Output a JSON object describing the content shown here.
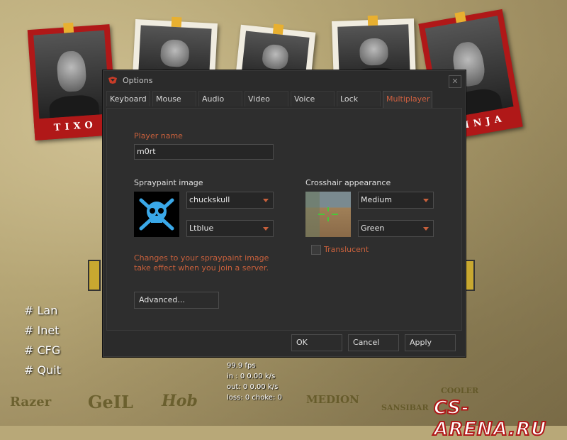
{
  "dialog": {
    "title": "Options",
    "close_symbol": "✕",
    "tabs": [
      {
        "label": "Keyboard"
      },
      {
        "label": "Mouse"
      },
      {
        "label": "Audio"
      },
      {
        "label": "Video"
      },
      {
        "label": "Voice"
      },
      {
        "label": "Lock"
      },
      {
        "label": "Multiplayer",
        "active": true
      }
    ],
    "player_name": {
      "label": "Player name",
      "value": "m0rt"
    },
    "spraypaint": {
      "label": "Spraypaint image",
      "image_select": "chuckskull",
      "color_select": "Ltblue",
      "note": "Changes to your spraypaint image take effect when you join a server."
    },
    "crosshair": {
      "label": "Crosshair appearance",
      "size_select": "Medium",
      "color_select": "Green",
      "translucent_label": "Translucent",
      "translucent_checked": false
    },
    "advanced_button": "Advanced...",
    "ok_button": "OK",
    "cancel_button": "Cancel",
    "apply_button": "Apply"
  },
  "menu": {
    "items": [
      "# Lan",
      "# Inet",
      "# CFG",
      "# Quit"
    ]
  },
  "netgraph": {
    "fps": "99.9 fps",
    "in": "in :  0 0.00 k/s",
    "out": "out:  0 0.00 k/s",
    "loss": "loss: 0 choke: 0"
  },
  "photos": {
    "left_name": "TIXO",
    "right_name": "NINJA"
  },
  "sponsors": [
    "Razer",
    "GeIL",
    "Hob",
    "MEDION",
    "SANSIBAR",
    "COOLER"
  ],
  "watermark": "CS-ARENA.RU",
  "colors": {
    "accent": "#c8603c",
    "dialog_bg": "#2b2b2b",
    "banner_red": "#b01818"
  }
}
